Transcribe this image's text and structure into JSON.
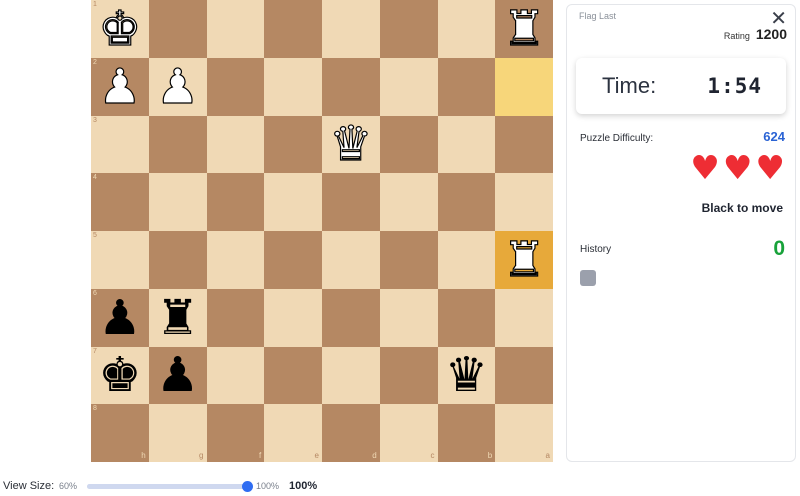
{
  "board": {
    "ranks": [
      "1",
      "2",
      "3",
      "4",
      "5",
      "6",
      "7",
      "8"
    ],
    "files": [
      "h",
      "g",
      "f",
      "e",
      "d",
      "c",
      "b",
      "a"
    ],
    "pieces": [
      {
        "square": "h1",
        "piece": "king",
        "color": "white",
        "glyph": "♚"
      },
      {
        "square": "a1",
        "piece": "rook",
        "color": "white",
        "glyph": "♜"
      },
      {
        "square": "h2",
        "piece": "pawn",
        "color": "white",
        "glyph": "♟"
      },
      {
        "square": "g2",
        "piece": "pawn",
        "color": "white",
        "glyph": "♟"
      },
      {
        "square": "d3",
        "piece": "queen",
        "color": "white",
        "glyph": "♛"
      },
      {
        "square": "a5",
        "piece": "rook",
        "color": "white",
        "glyph": "♜"
      },
      {
        "square": "h6",
        "piece": "pawn",
        "color": "black",
        "glyph": "♟"
      },
      {
        "square": "g6",
        "piece": "rook",
        "color": "black",
        "glyph": "♜"
      },
      {
        "square": "h7",
        "piece": "king",
        "color": "black",
        "glyph": "♚"
      },
      {
        "square": "g7",
        "piece": "pawn",
        "color": "black",
        "glyph": "♟"
      },
      {
        "square": "b7",
        "piece": "queen",
        "color": "black",
        "glyph": "♛"
      }
    ],
    "last_move": {
      "from": "a2",
      "to": "a5"
    }
  },
  "panel": {
    "flag_label": "Flag Last",
    "close_icon": "close-icon",
    "rating_label": "Rating",
    "rating_value": "1200",
    "timer_label": "Time:",
    "timer_value": "1:54",
    "difficulty_label": "Puzzle Difficulty:",
    "difficulty_value": "624",
    "lives": 3,
    "heart_glyph": "♥",
    "turn_text": "Black to move",
    "history_label": "History",
    "history_count": "0"
  },
  "view_size": {
    "label": "View Size:",
    "min_label": "60%",
    "max_label": "100%",
    "current": "100%",
    "value_fraction": 1.0
  },
  "colors": {
    "light_square": "#f0d9b5",
    "dark_square": "#b58863",
    "highlight_light": "#f7d67a",
    "highlight_dark": "#e7a93a",
    "accent_blue": "#2a63d4",
    "history_green": "#18a23a",
    "heart_red": "#ee2d34"
  }
}
